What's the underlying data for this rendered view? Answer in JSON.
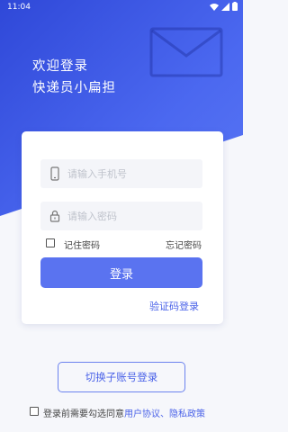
{
  "status_bar": {
    "time": "11:04",
    "icons": [
      "wifi-icon",
      "signal-icon",
      "battery-icon"
    ]
  },
  "header": {
    "line1": "欢迎登录",
    "line2": "快递员小扁担"
  },
  "form": {
    "phone_placeholder": "请输入手机号",
    "password_placeholder": "请输入密码",
    "remember_label": "记住密码",
    "forgot_label": "忘记密码",
    "login_label": "登录",
    "sms_login_label": "验证码登录"
  },
  "switch_account_label": "切换子账号登录",
  "agreement": {
    "prefix": "登录前需要勾选同意",
    "user_agreement": "用户协议",
    "separator": "、",
    "privacy_policy": "隐私政策"
  },
  "colors": {
    "primary": "#5a73f0",
    "link": "#4a62e8",
    "hero_start": "#2f48d8",
    "hero_end": "#5a77f4"
  }
}
